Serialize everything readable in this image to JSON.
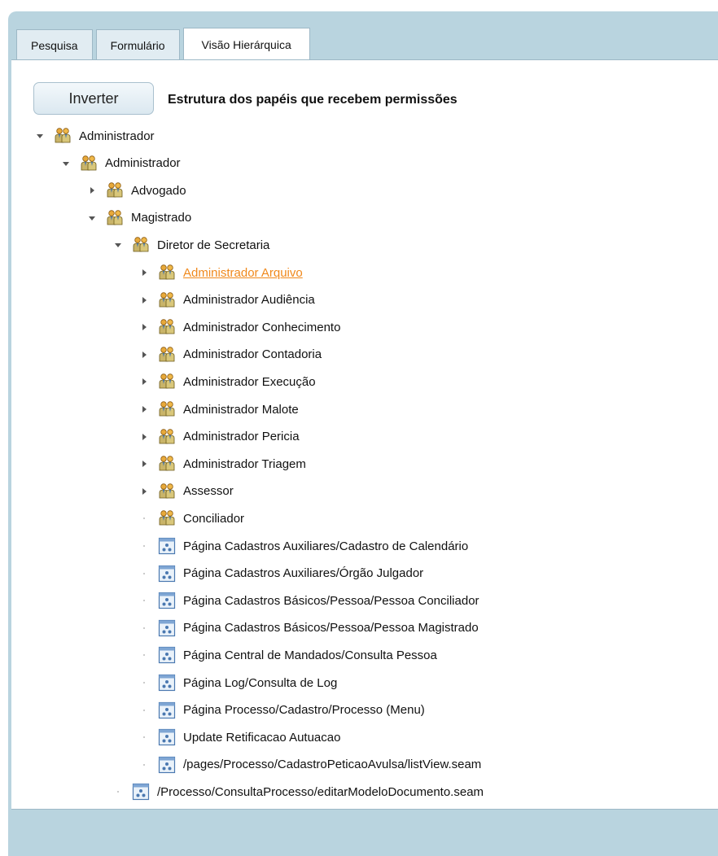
{
  "tabs": [
    {
      "label": "Pesquisa",
      "active": false
    },
    {
      "label": "Formulário",
      "active": false
    },
    {
      "label": "Visão Hierárquica",
      "active": true
    }
  ],
  "invert_button": "Inverter",
  "tree_title": "Estrutura dos papéis que recebem permissões",
  "tree": [
    {
      "label": "Administrador",
      "depth": 0,
      "toggle": "expanded",
      "icon": "users-icon"
    },
    {
      "label": "Administrador",
      "depth": 1,
      "toggle": "expanded",
      "icon": "users-icon"
    },
    {
      "label": "Advogado",
      "depth": 2,
      "toggle": "collapsed",
      "icon": "users-icon"
    },
    {
      "label": "Magistrado",
      "depth": 2,
      "toggle": "expanded",
      "icon": "users-icon"
    },
    {
      "label": "Diretor de Secretaria",
      "depth": 3,
      "toggle": "expanded",
      "icon": "users-icon"
    },
    {
      "label": "Administrador Arquivo",
      "depth": 4,
      "toggle": "collapsed",
      "icon": "users-icon",
      "link": true
    },
    {
      "label": "Administrador Audiência",
      "depth": 4,
      "toggle": "collapsed",
      "icon": "users-icon"
    },
    {
      "label": "Administrador Conhecimento",
      "depth": 4,
      "toggle": "collapsed",
      "icon": "users-icon"
    },
    {
      "label": "Administrador Contadoria",
      "depth": 4,
      "toggle": "collapsed",
      "icon": "users-icon"
    },
    {
      "label": "Administrador Execução",
      "depth": 4,
      "toggle": "collapsed",
      "icon": "users-icon"
    },
    {
      "label": "Administrador Malote",
      "depth": 4,
      "toggle": "collapsed",
      "icon": "users-icon"
    },
    {
      "label": "Administrador Pericia",
      "depth": 4,
      "toggle": "collapsed",
      "icon": "users-icon"
    },
    {
      "label": "Administrador Triagem",
      "depth": 4,
      "toggle": "collapsed",
      "icon": "users-icon"
    },
    {
      "label": "Assessor",
      "depth": 4,
      "toggle": "collapsed",
      "icon": "users-icon"
    },
    {
      "label": "Conciliador",
      "depth": 4,
      "toggle": "leaf",
      "icon": "users-icon"
    },
    {
      "label": "Página Cadastros Auxiliares/Cadastro de Calendário",
      "depth": 4,
      "toggle": "leaf",
      "icon": "page-icon"
    },
    {
      "label": "Página Cadastros Auxiliares/Órgão Julgador",
      "depth": 4,
      "toggle": "leaf",
      "icon": "page-icon"
    },
    {
      "label": "Página Cadastros Básicos/Pessoa/Pessoa Conciliador",
      "depth": 4,
      "toggle": "leaf",
      "icon": "page-icon"
    },
    {
      "label": "Página Cadastros Básicos/Pessoa/Pessoa Magistrado",
      "depth": 4,
      "toggle": "leaf",
      "icon": "page-icon"
    },
    {
      "label": "Página Central de Mandados/Consulta Pessoa",
      "depth": 4,
      "toggle": "leaf",
      "icon": "page-icon"
    },
    {
      "label": "Página Log/Consulta de Log",
      "depth": 4,
      "toggle": "leaf",
      "icon": "page-icon"
    },
    {
      "label": "Página Processo/Cadastro/Processo (Menu)",
      "depth": 4,
      "toggle": "leaf",
      "icon": "page-icon"
    },
    {
      "label": "Update Retificacao Autuacao",
      "depth": 4,
      "toggle": "leaf",
      "icon": "page-icon"
    },
    {
      "label": "/pages/Processo/CadastroPeticaoAvulsa/listView.seam",
      "depth": 4,
      "toggle": "leaf",
      "icon": "page-icon"
    },
    {
      "label": "/Processo/ConsultaProcesso/editarModeloDocumento.seam",
      "depth": 3,
      "toggle": "leaf",
      "icon": "page-icon"
    }
  ],
  "colors": {
    "frame": "#b9d4df",
    "link": "#f0891c",
    "tab_inactive": "#e1ecf2"
  }
}
